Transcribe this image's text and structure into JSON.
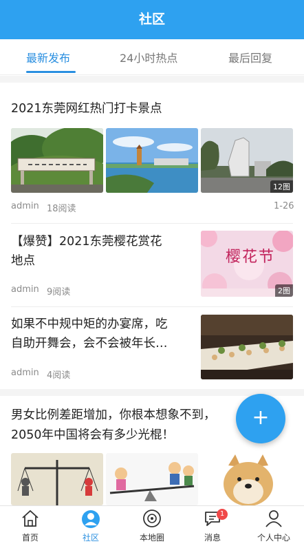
{
  "header": {
    "title": "社区"
  },
  "tabs": [
    {
      "label": "最新发布",
      "active": true
    },
    {
      "label": "24小时热点",
      "active": false
    },
    {
      "label": "最后回复",
      "active": false
    }
  ],
  "posts": [
    {
      "title": "2021东莞网红热门打卡景点",
      "author": "admin",
      "reads": "18阅读",
      "date": "1-26",
      "image_count": "12图"
    },
    {
      "title_line1": "【爆赞】2021东莞樱花赏花",
      "title_line2": "地点",
      "author": "admin",
      "reads": "9阅读",
      "image_count": "2图",
      "poster_text": "樱花节"
    },
    {
      "title_line1": "如果不中规中矩的办宴席，吃",
      "title_line2": "自助开舞会，会不会被年长…",
      "author": "admin",
      "reads": "4阅读"
    },
    {
      "title_line1": "男女比例差距增加，你根本想象不到，",
      "title_line2": "2050年中国将会有多少光棍！"
    }
  ],
  "fab": {
    "icon": "plus-icon",
    "label": "+"
  },
  "bottom_nav": [
    {
      "label": "首页",
      "icon": "home-icon",
      "active": false
    },
    {
      "label": "社区",
      "icon": "community-icon",
      "active": true
    },
    {
      "label": "本地圈",
      "icon": "local-circle-icon",
      "active": false
    },
    {
      "label": "消息",
      "icon": "message-icon",
      "active": false,
      "badge": "1"
    },
    {
      "label": "个人中心",
      "icon": "profile-icon",
      "active": false
    }
  ],
  "colors": {
    "primary": "#2ea1f0",
    "active_tab": "#2a8fe0",
    "badge": "#f04848"
  }
}
